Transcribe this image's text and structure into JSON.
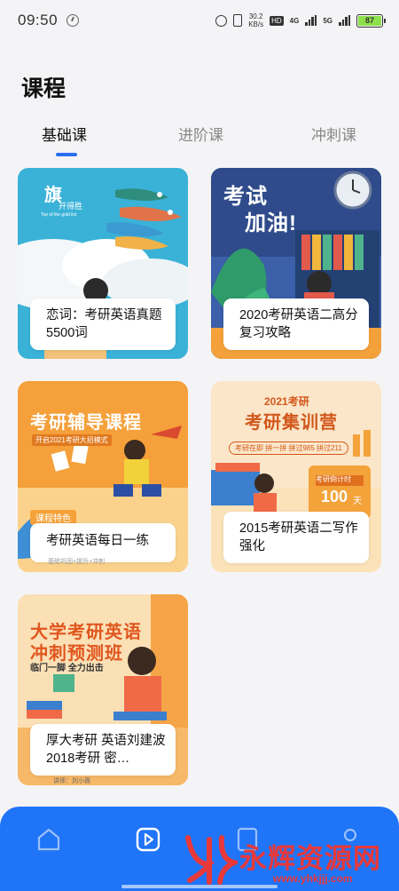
{
  "status_bar": {
    "time": "09:50",
    "speed_value": "30.2",
    "speed_unit": "KB/s",
    "hd_label": "HD",
    "network_4g": "4G",
    "network_5g": "5G",
    "battery": "87"
  },
  "header": {
    "title": "课程"
  },
  "tabs": [
    {
      "label": "基础课",
      "active": true
    },
    {
      "label": "进阶课",
      "active": false
    },
    {
      "label": "冲刺课",
      "active": false
    }
  ],
  "courses": [
    {
      "title": "恋词：考研英语真题5500词"
    },
    {
      "title": "2020考研英语二高分复习攻略"
    },
    {
      "title": "考研英语每日一练"
    },
    {
      "title": "2015考研英语二写作强化"
    },
    {
      "title": "厚大考研 英语刘建波 2018考研 密…"
    }
  ],
  "card_art": {
    "card1_logo": "旗",
    "card1_brand": "开得胜",
    "card1_tagline": "Top of the gold list",
    "card2_line1": "考试",
    "card2_line2": "加油!",
    "card3_heading": "考研辅导课程",
    "card3_sub": "开启2021考研大招模式",
    "card3_tag": "课程特色",
    "card3_footnote": "基础巩固+提升+冲刺",
    "card4_year": "2021考研",
    "card4_heading": "考研集训营",
    "card4_sub": "考研在即 拼一拼 拼过985 拼过211",
    "card4_countdown": "考研倒计时",
    "card4_days": "100",
    "card4_days_unit": "天",
    "card5_line1": "大学考研英语",
    "card5_line2": "冲刺预测班",
    "card5_sub": "临门一脚 全力出击",
    "card5_footer": "讲师：刘小薇"
  },
  "bottom_nav": [
    {
      "icon": "home-icon"
    },
    {
      "icon": "play-icon"
    },
    {
      "icon": "book-icon"
    },
    {
      "icon": "profile-icon"
    }
  ],
  "watermark": {
    "name": "永辉资源网",
    "url": "www.yhkjjj.com"
  },
  "colors": {
    "accent": "#2b6ef5",
    "nav_bg": "#1f74f7",
    "watermark": "#e8393a"
  }
}
